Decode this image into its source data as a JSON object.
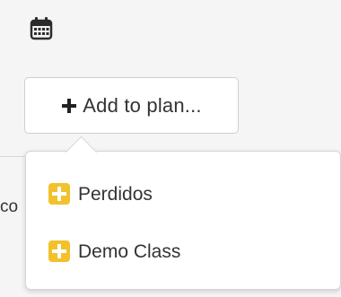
{
  "icons": {
    "calendar": "calendar-icon",
    "plus": "plus-icon",
    "plus_square": "plus-square-icon"
  },
  "colors": {
    "accent": "#f3c12c",
    "text": "#333333",
    "icon_dark": "#2c2c2c"
  },
  "toolbar": {
    "add_label": "Add to plan..."
  },
  "background": {
    "fragment_text": "co"
  },
  "dropdown": {
    "items": [
      {
        "label": "Perdidos"
      },
      {
        "label": "Demo Class"
      }
    ]
  }
}
